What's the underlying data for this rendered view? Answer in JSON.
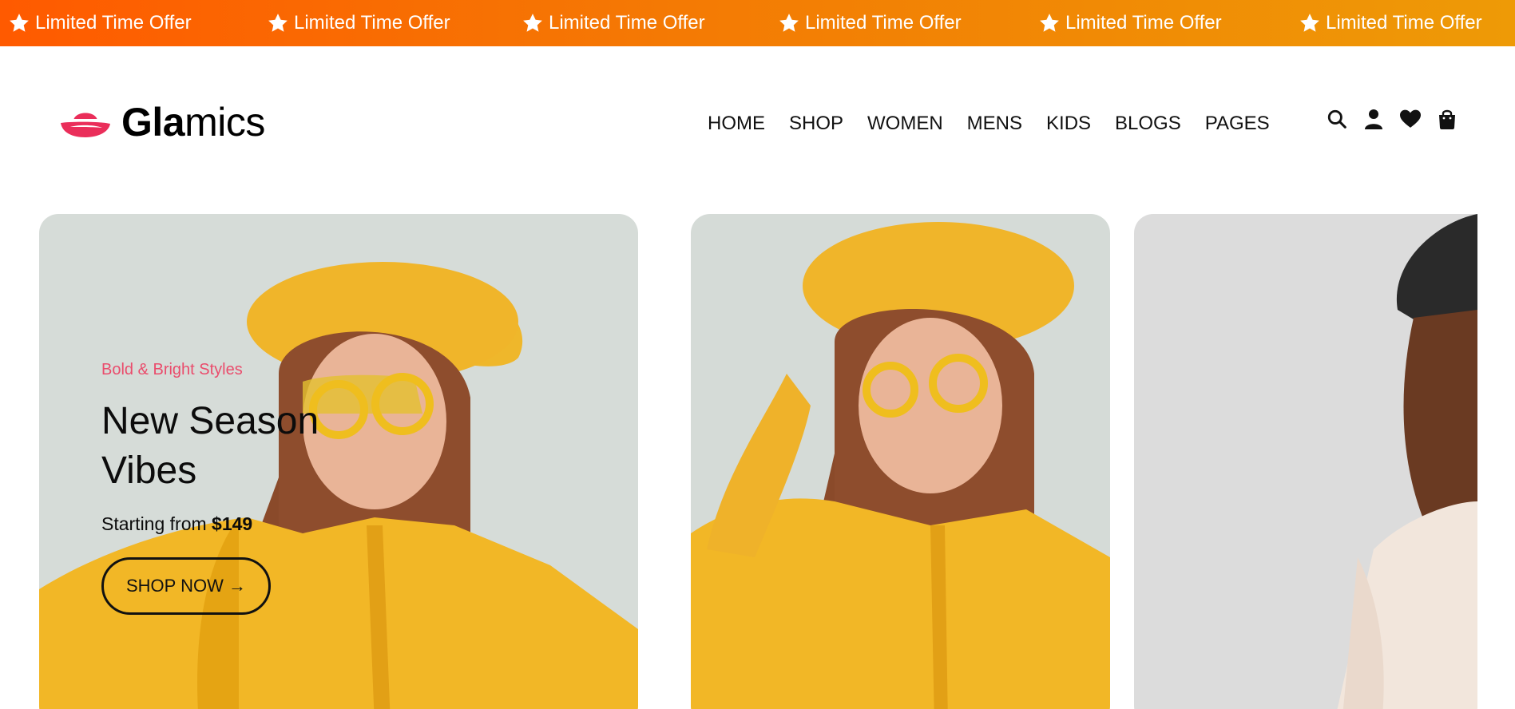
{
  "promo": {
    "items": [
      "Limited Time Offer",
      "Limited Time Offer",
      "Limited Time Offer",
      "Limited Time Offer",
      "Limited Time Offer",
      "Limited Time Offer"
    ],
    "icon": "star-icon",
    "gradient_start": "#ff5a00",
    "gradient_end": "#ee9a06"
  },
  "brand": {
    "name_bold": "Gla",
    "name_regular": "mics",
    "logo_icon": "hat-icon",
    "logo_color": "#ea2e5a"
  },
  "nav": {
    "items": [
      "HOME",
      "SHOP",
      "WOMEN",
      "MENS",
      "KIDS",
      "BLOGS",
      "PAGES"
    ]
  },
  "header_icons": [
    "search-icon",
    "user-icon",
    "heart-icon",
    "bag-icon"
  ],
  "hero": {
    "subtitle": "Bold & Bright Styles",
    "title_line1": "New Season",
    "title_line2": "Vibes",
    "price_prefix": "Starting from ",
    "price_amount": "$149",
    "button_label": "SHOP NOW →",
    "accent_color": "#ea4c6c"
  }
}
